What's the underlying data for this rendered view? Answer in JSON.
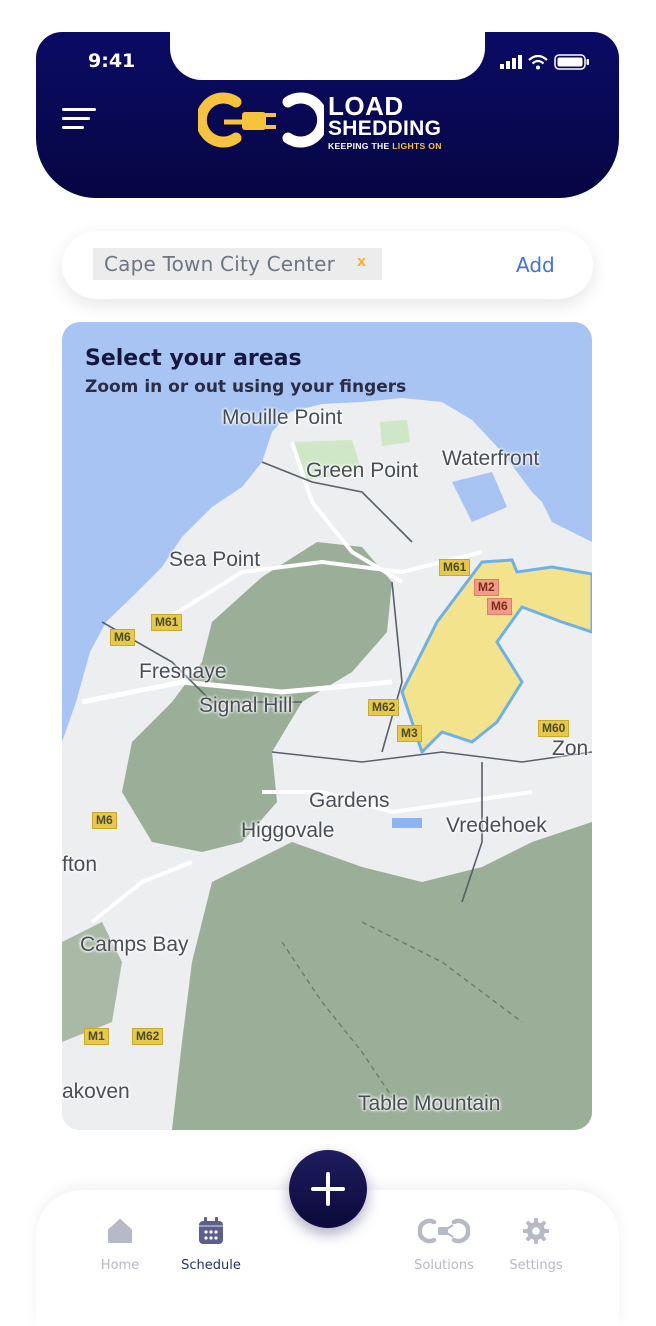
{
  "status_bar": {
    "time": "9:41"
  },
  "header": {
    "brand_line1": "LOAD",
    "brand_line2": "SHEDDING",
    "tagline_part1": "KEEPING THE ",
    "tagline_highlight": "LIGHTS ON"
  },
  "search": {
    "chip_label": "Cape Town City Center",
    "chip_close": "x",
    "add_label": "Add"
  },
  "map": {
    "title": "Select your areas",
    "subtitle": "Zoom in or out using your fingers",
    "place_labels": [
      "Mouille Point",
      "Green Point",
      "Waterfront",
      "Sea Point",
      "Fresnaye",
      "Signal Hill",
      "Gardens",
      "Higgovale",
      "Vredehoek",
      "Camps Bay",
      "Table Mountain",
      "fton",
      "akoven",
      "Zon"
    ],
    "road_labels": [
      "M61",
      "M6",
      "M61",
      "M62",
      "M6",
      "M2",
      "M60",
      "M6",
      "M3",
      "M62",
      "M1"
    ]
  },
  "nav": {
    "items": [
      {
        "label": "Home"
      },
      {
        "label": "Schedule"
      },
      {
        "label": "Solutions"
      },
      {
        "label": "Settings"
      }
    ]
  },
  "colors": {
    "header_bg": "#060642",
    "accent_yellow": "#f7c23c",
    "link_blue": "#3d72e6",
    "selected_area": "#f5e07a"
  }
}
